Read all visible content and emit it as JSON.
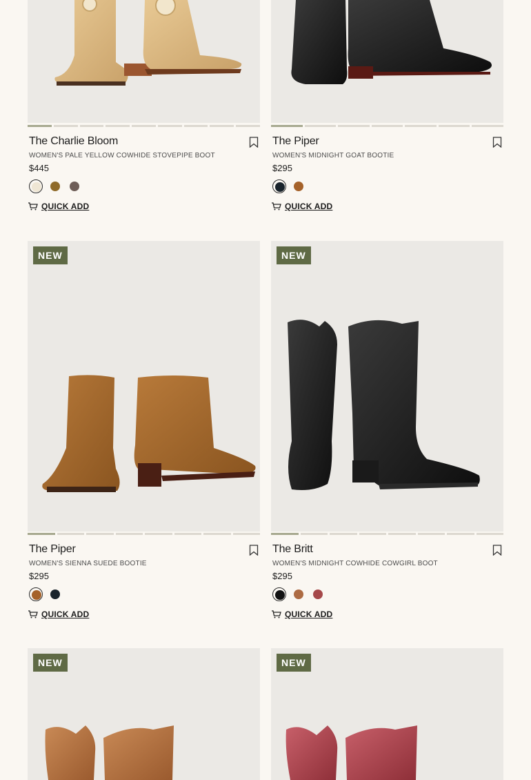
{
  "colors": {
    "badge_bg": "#5f6a45",
    "image_bg": "#ebe9e5",
    "page_bg": "#faf7f2"
  },
  "quick_add_icon": "cart-icon",
  "bookmark_icon": "bookmark-icon",
  "products": [
    {
      "name": "The Charlie Bloom",
      "description": "WOMEN'S PALE YELLOW COWHIDE STOVEPIPE BOOT",
      "price": "$445",
      "badge": "",
      "quick_add": "QUICK ADD",
      "swatches": [
        "#efe6d4",
        "#8f6b2a",
        "#6e5e58"
      ],
      "selected_swatch": 0,
      "image_slides": 9,
      "active_slide": 0
    },
    {
      "name": "The Piper",
      "description": "WOMEN'S MIDNIGHT GOAT BOOTIE",
      "price": "$295",
      "badge": "",
      "quick_add": "QUICK ADD",
      "swatches": [
        "#1a242c",
        "#a5622a"
      ],
      "selected_swatch": 0,
      "image_slides": 7,
      "active_slide": 0
    },
    {
      "name": "The Piper",
      "description": "WOMEN'S SIENNA SUEDE BOOTIE",
      "price": "$295",
      "badge": "NEW",
      "quick_add": "QUICK ADD",
      "swatches": [
        "#a5622a",
        "#1a242c"
      ],
      "selected_swatch": 0,
      "image_slides": 8,
      "active_slide": 0
    },
    {
      "name": "The Britt",
      "description": "WOMEN'S MIDNIGHT COWHIDE COWGIRL BOOT",
      "price": "$295",
      "badge": "NEW",
      "quick_add": "QUICK ADD",
      "swatches": [
        "#121212",
        "#ad6b43",
        "#a5484a"
      ],
      "selected_swatch": 0,
      "image_slides": 8,
      "active_slide": 0
    },
    {
      "name": "",
      "description": "",
      "price": "",
      "badge": "NEW",
      "quick_add": "",
      "swatches": [],
      "selected_swatch": 0,
      "image_slides": 0,
      "active_slide": 0
    },
    {
      "name": "",
      "description": "",
      "price": "",
      "badge": "NEW",
      "quick_add": "",
      "swatches": [],
      "selected_swatch": 0,
      "image_slides": 0,
      "active_slide": 0
    }
  ]
}
